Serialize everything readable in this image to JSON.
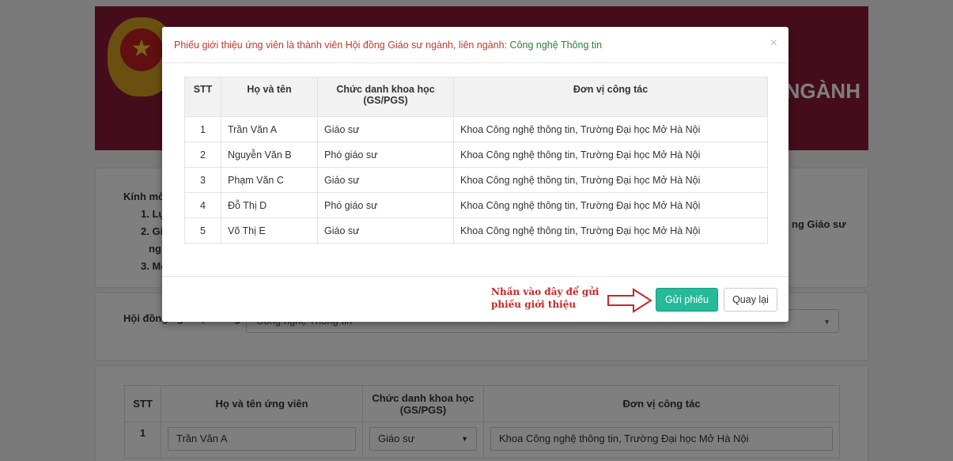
{
  "background": {
    "banner_title": "NGÀNH",
    "notice_intro": "Kính mờ",
    "notice_items": [
      "1. Lụ",
      "2. Gi",
      "ng",
      "3. Mở"
    ],
    "notice_right": "ng Giáo sư",
    "council_label": "Hội đồng ngành, liên ngành",
    "council_value": "Công nghệ Thông tin",
    "table": {
      "headers": [
        "STT",
        "Họ và tên ứng viên",
        "Chức danh khoa học (GS/PGS)",
        "Đơn vị công tác"
      ],
      "row": {
        "stt": "1",
        "name": "Trần Văn A",
        "title": "Giáo sư",
        "unit": "Khoa Công nghệ thông tin, Trường Đại học Mở Hà Nội"
      }
    }
  },
  "modal": {
    "title_prefix": "Phiếu giới thiệu ứng viên là thành viên Hội đồng Giáo sư ngành, liên ngành:",
    "title_field": "Công nghệ Thông tin",
    "close_icon": "×",
    "table": {
      "headers": [
        "STT",
        "Họ và tên",
        "Chức danh khoa học (GS/PGS)",
        "Đơn vị công tác"
      ],
      "rows": [
        {
          "stt": "1",
          "name": "Trần Văn A",
          "title": "Giáo sư",
          "unit": "Khoa Công nghệ thông tin, Trường Đại học Mở Hà Nội"
        },
        {
          "stt": "2",
          "name": "Nguyễn Văn B",
          "title": "Phó giáo sư",
          "unit": "Khoa Công nghệ thông tin, Trường Đại học Mở Hà Nội"
        },
        {
          "stt": "3",
          "name": "Phạm Văn C",
          "title": "Giáo sư",
          "unit": "Khoa Công nghệ thông tin, Trường Đại học Mở Hà Nội"
        },
        {
          "stt": "4",
          "name": "Đỗ Thị D",
          "title": "Phó giáo sư",
          "unit": "Khoa Công nghệ thông tin, Trường Đại học Mở Hà Nội"
        },
        {
          "stt": "5",
          "name": "Võ Thị E",
          "title": "Giáo sư",
          "unit": "Khoa Công nghệ thông tin, Trường Đại học Mở Hà Nội"
        }
      ]
    },
    "note_line1": "Nhấn vào đây để gửi",
    "note_line2": "phiếu giới thiệu",
    "send_label": "Gửi phiếu",
    "back_label": "Quay lại"
  },
  "colors": {
    "banner": "#8a1b36",
    "primary_button": "#26b99a",
    "title_red": "#c0392b",
    "title_green": "#2e7d32",
    "annotation_red": "#c62828"
  },
  "icons": [
    "close-icon",
    "arrow-right-icon",
    "caret-down-icon",
    "star-icon"
  ]
}
